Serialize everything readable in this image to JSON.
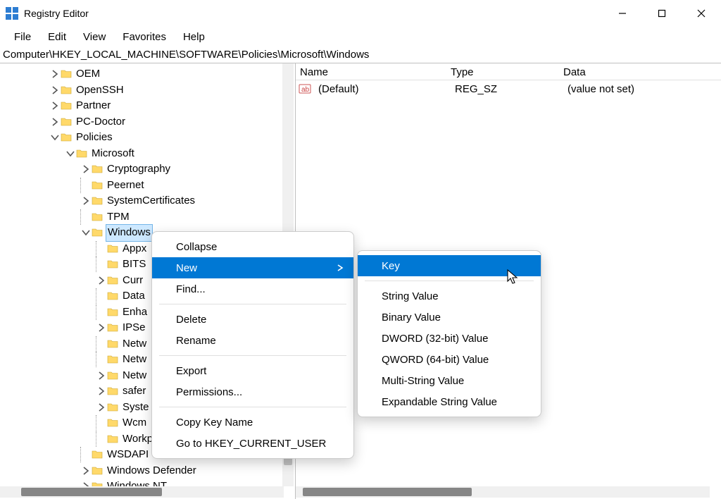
{
  "title": "Registry Editor",
  "menubar": {
    "file": "File",
    "edit": "Edit",
    "view": "View",
    "favorites": "Favorites",
    "help": "Help"
  },
  "address": "Computer\\HKEY_LOCAL_MACHINE\\SOFTWARE\\Policies\\Microsoft\\Windows",
  "valuepane": {
    "cols": {
      "name": "Name",
      "type": "Type",
      "data": "Data"
    },
    "row": {
      "name": "(Default)",
      "type": "REG_SZ",
      "data": "(value not set)"
    }
  },
  "tree": {
    "oem": "OEM",
    "openssh": "OpenSSH",
    "partner": "Partner",
    "pcdoctor": "PC-Doctor",
    "policies": "Policies",
    "microsoft": "Microsoft",
    "cryptography": "Cryptography",
    "peernet": "Peernet",
    "systemcerts": "SystemCertificates",
    "tpm": "TPM",
    "windows": "Windows",
    "appx": "Appx",
    "bits": "BITS",
    "curr": "Curr",
    "data": "Data",
    "enha": "Enha",
    "ipse": "IPSe",
    "netw1": "Netw",
    "netw2": "Netw",
    "netw3": "Netw",
    "safer": "safer",
    "syste": "Syste",
    "wcm": "Wcm",
    "workplacejoin": "WorkplaceJoin",
    "wsdapi": "WSDAPI",
    "windefender": "Windows Defender",
    "winnt": "Windows NT"
  },
  "ctxmenu": {
    "collapse": "Collapse",
    "new": "New",
    "find": "Find...",
    "delete": "Delete",
    "rename": "Rename",
    "export": "Export",
    "permissions": "Permissions...",
    "copykey": "Copy Key Name",
    "gotohkcu": "Go to HKEY_CURRENT_USER"
  },
  "submenu": {
    "key": "Key",
    "string": "String Value",
    "binary": "Binary Value",
    "dword": "DWORD (32-bit) Value",
    "qword": "QWORD (64-bit) Value",
    "multistring": "Multi-String Value",
    "expandable": "Expandable String Value"
  }
}
